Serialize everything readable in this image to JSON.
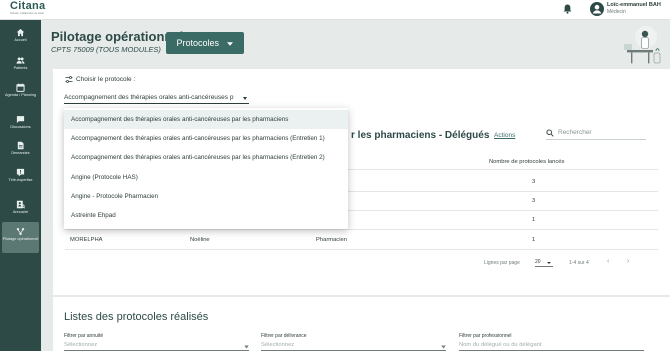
{
  "topbar": {
    "logo": "Citana",
    "logo_tagline": "Solution collaborative de santé",
    "user_name": "Loïc-emmanuel BAH",
    "user_role": "Médecin"
  },
  "sidebar": {
    "items": [
      {
        "label": "Accueil",
        "icon": "home-icon"
      },
      {
        "label": "Patients",
        "icon": "patients-icon"
      },
      {
        "label": "Agenda / Planning",
        "icon": "calendar-icon"
      },
      {
        "label": "Discussions",
        "icon": "chat-icon"
      },
      {
        "label": "Demandes",
        "icon": "requests-icon"
      },
      {
        "label": "Télé-expertise",
        "icon": "tele-expertise-icon"
      },
      {
        "label": "Annuaire",
        "icon": "directory-icon"
      },
      {
        "label": "Pilotage opérationnel",
        "icon": "pilotage-icon"
      }
    ]
  },
  "header": {
    "title": "Pilotage opérationnel",
    "subtitle": "CPTS 75009 (TOUS MODULES)",
    "protocol_button": "Protocoles"
  },
  "protocol_select": {
    "label": "Choisir le protocole :",
    "value": "Accompagnement des thérapies orales anti-cancéreuses p"
  },
  "dropdown": {
    "options": [
      "Accompagnement des thérapies orales anti-cancéreuses par les pharmaciens",
      "Accompagnement des thérapies orales anti-cancéreuses par les pharmaciens (Entretien 1)",
      "Accompagnement des thérapies orales anti-cancéreuses par les pharmaciens (Entretien 2)",
      "Angine (Protocole HAS)",
      "Angine - Protocole Pharmacien",
      "Astreinte Ehpad"
    ],
    "selected_index": 0
  },
  "delegates": {
    "title": "r les pharmaciens - Délégués",
    "actions_link": "Actions",
    "search_placeholder": "Rechercher",
    "column_count": "Nombre de protocoles lancés",
    "rows": [
      {
        "count": "3"
      },
      {
        "count": "3"
      },
      {
        "count": "1"
      },
      {
        "last_name": "MORELPHA",
        "first_name": "Noëline",
        "profession": "Pharmacien",
        "count": "1"
      }
    ],
    "pagination": {
      "rows_per_page_label": "Lignes par page",
      "rows_per_page": "20",
      "range": "1-4 sur 4",
      "prev": "‹",
      "next": "›"
    }
  },
  "realized": {
    "title": "Listes des protocoles réalisés",
    "filters": [
      {
        "label": "Filtrer par annuité",
        "placeholder": "Sélectionnez"
      },
      {
        "label": "Filtrer par délivrance",
        "placeholder": "Sélectionnez"
      },
      {
        "label": "Filtrer par professionnel",
        "placeholder": "Nom du délégué ou du délégant"
      }
    ]
  },
  "colors": {
    "sidebar_bg": "#2d4a47",
    "button_bg": "#3b6b65",
    "page_bg": "#e6ebea"
  }
}
